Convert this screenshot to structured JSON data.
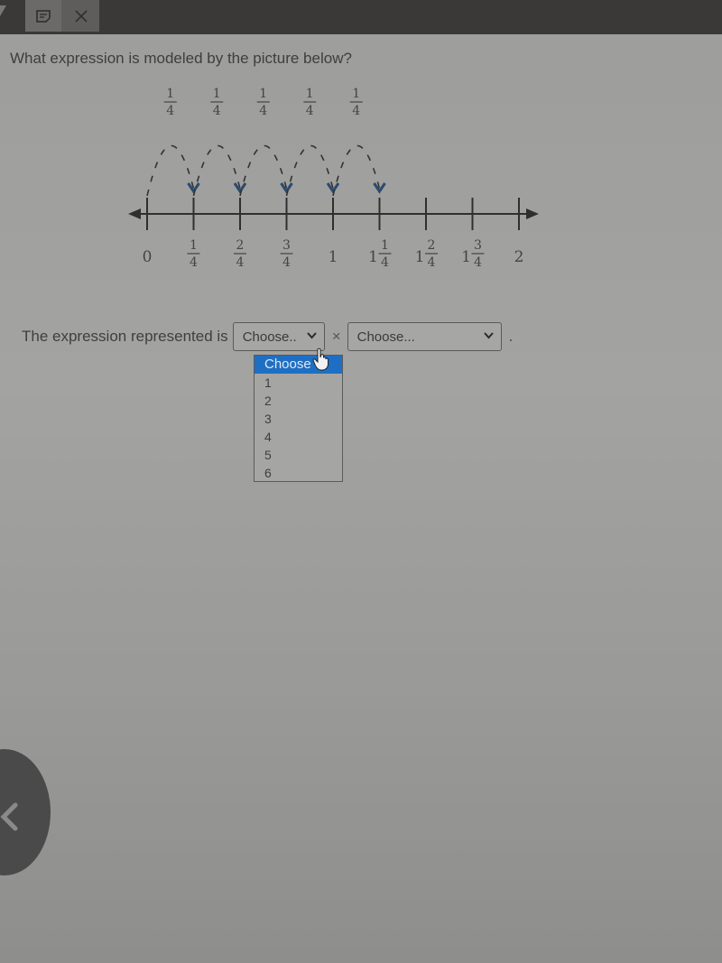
{
  "toolbar": {
    "icons": [
      "cursor-icon",
      "sticky-note-icon",
      "close-icon"
    ],
    "close_glyph": "✕"
  },
  "question": "What expression is modeled by the picture below?",
  "number_line": {
    "jump_labels": [
      "1/4",
      "1/4",
      "1/4",
      "1/4",
      "1/4"
    ],
    "jump_label_parts": [
      {
        "num": "1",
        "den": "4"
      },
      {
        "num": "1",
        "den": "4"
      },
      {
        "num": "1",
        "den": "4"
      },
      {
        "num": "1",
        "den": "4"
      },
      {
        "num": "1",
        "den": "4"
      }
    ],
    "jumps": 5,
    "jump_size": 0.25,
    "range": [
      0,
      2
    ],
    "ticks": [
      {
        "whole": "0",
        "num": "",
        "den": ""
      },
      {
        "whole": "",
        "num": "1",
        "den": "4"
      },
      {
        "whole": "",
        "num": "2",
        "den": "4"
      },
      {
        "whole": "",
        "num": "3",
        "den": "4"
      },
      {
        "whole": "1",
        "num": "",
        "den": ""
      },
      {
        "whole": "1",
        "num": "1",
        "den": "4"
      },
      {
        "whole": "1",
        "num": "2",
        "den": "4"
      },
      {
        "whole": "1",
        "num": "3",
        "den": "4"
      },
      {
        "whole": "2",
        "num": "",
        "den": ""
      }
    ],
    "arrow_color": "#2c4a6e"
  },
  "expression": {
    "label": "The expression represented is",
    "select1_value": "Choose..",
    "operator": "×",
    "select2_value": "Choose...",
    "period": ".",
    "chevron": "⌄"
  },
  "dropdown": {
    "options": [
      "Choose",
      "1",
      "2",
      "3",
      "4",
      "5",
      "6"
    ],
    "highlighted_index": 0,
    "highlight_color": "#1e6fc4"
  },
  "nav": {
    "back_glyph": "<"
  }
}
